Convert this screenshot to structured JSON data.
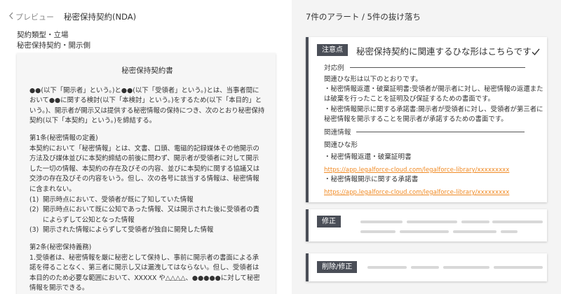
{
  "nav": {
    "back_label": "プレビュー",
    "doc_title": "秘密保持契約(NDA)"
  },
  "meta": {
    "line1": "契約類型・立場",
    "line2": "秘密保持契約・開示側"
  },
  "document": {
    "title": "秘密保持契約書",
    "preamble": "●●(以下「開示者」という。)と●●(以下「受領者」という。)とは、当事者間において●●に関する検討(以下「本検討」という。)をするため(以下「本目的」という。)、開示者が開示又は提供する秘密情報の保持につき、次のとおり秘密保持契約(以下「本契約」という。)を締結する。",
    "art1_heading": "第1条(秘密情報の定義)",
    "art1_body": "本契約において「秘密情報」とは、文書、口頭、電磁的記録媒体その他開示の方法及び媒体並びに本契約締結の前後に問わず、開示者が受領者に対して開示した一切の情報、本契約の存在及びその内容、並びに本契約に関する協議又は交渉の存在及びその内容をいう。但し、次の各号に該当する情報は、秘密情報に含まれない。",
    "art1_items": [
      {
        "num": "(1)",
        "text": "開示時点において、受領者が既に了知していた情報"
      },
      {
        "num": "(2)",
        "text": "開示時点において既に公知であった情報、又は開示された後に受領者の責によらずして公知となった情報"
      },
      {
        "num": "(3)",
        "text": "開示された情報によらずして受領者が独自に開発した情報"
      }
    ],
    "art2_heading": "第2条(秘密保持義務)",
    "art2_body": "1.受領者は、秘密情報を厳に秘密として保持し、事前に開示者の書面による承諾を得ることなく、第三者に開示し又は漏洩してはならない。但し、受領者は本目的のため必要な範囲において、XXXXX や△△△△、●●●●●に対して秘密情報を開示できる。"
  },
  "alerts": {
    "header": "7件のアラート / 5件の抜け落ち",
    "card1": {
      "badge": "注意点",
      "title": "秘密保持契約に関連するひな形はこちらです",
      "example_label": "対応例",
      "example_text": "関連ひな形は以下のとおりです。\n・秘密情報返還・破棄証明書:受領者が開示者に対し、秘密情報の返還または破棄を行ったことを証明及び保証するための書面です。\n・秘密情報開示に関する承諾書:開示者が受領者に対し、受領者が第三者に秘密情報を開示することを開示者が承諾するための書面です。",
      "related_label": "関連情報",
      "templates_label": "関連ひな形",
      "templates": [
        {
          "title": "・秘密情報返還・破棄証明書",
          "url": "https://app.legalforce-cloud.com/legalforce-library/xxxxxxxxx"
        },
        {
          "title": "・秘密情報開示に関する承諾書",
          "url": "https://app.legalforce-cloud.com/legalforce-library/xxxxxxxxx"
        }
      ]
    },
    "card2": {
      "badge": "修正"
    },
    "card3": {
      "badge": "削除/修正"
    }
  },
  "colors": {
    "badge_bg": "#4a4e57",
    "link": "#f08a24",
    "panel_bg": "#f4f4f4",
    "paper_bg": "#f6f6f6"
  }
}
